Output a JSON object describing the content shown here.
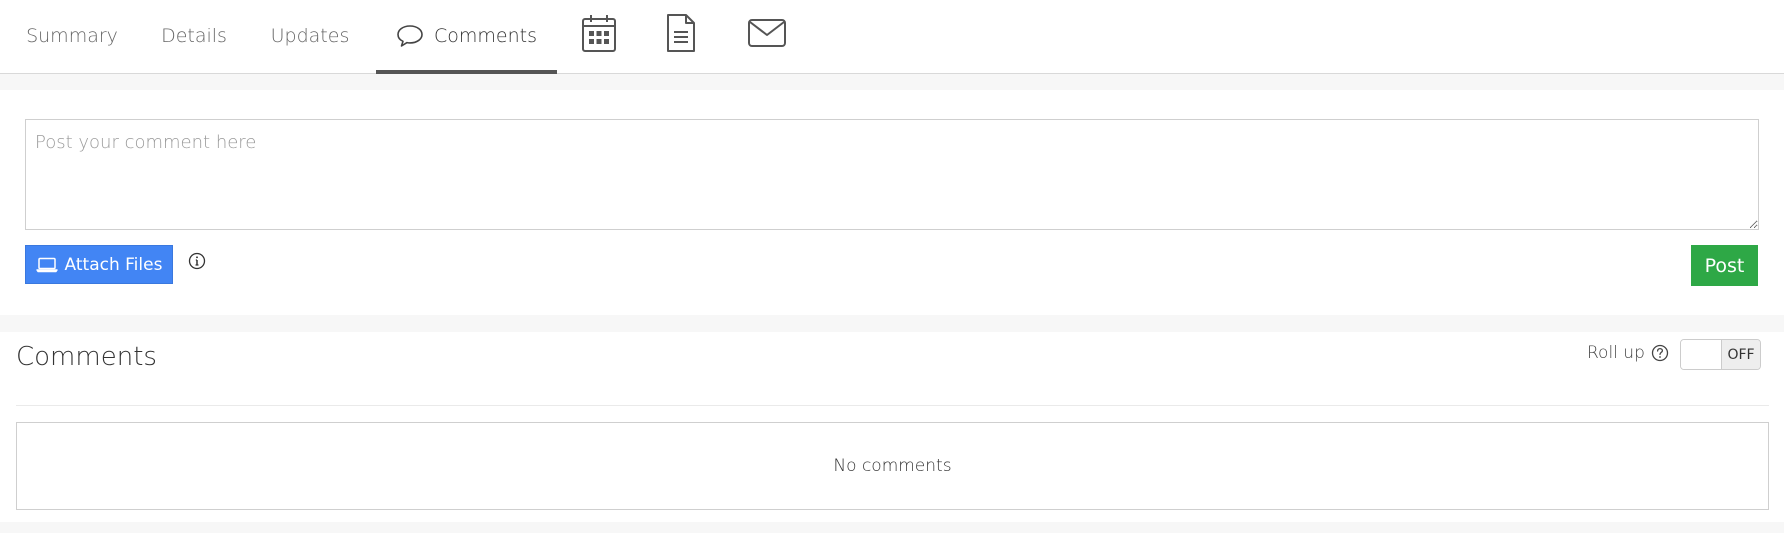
{
  "tabs": {
    "summary": "Summary",
    "details": "Details",
    "updates": "Updates",
    "comments": "Comments",
    "active": "comments",
    "icon_tabs": [
      "calendar-icon",
      "document-icon",
      "email-icon"
    ]
  },
  "compose": {
    "placeholder": "Post your comment here",
    "value": "",
    "attach_label": "Attach Files",
    "post_label": "Post"
  },
  "comments": {
    "title": "Comments",
    "rollup_label": "Roll up",
    "rollup_state": "OFF",
    "empty_text": "No comments"
  },
  "colors": {
    "attach_button": "#4285f4",
    "post_button": "#2ea846",
    "active_tab_underline": "#555555",
    "background": "#f7f7f7"
  }
}
